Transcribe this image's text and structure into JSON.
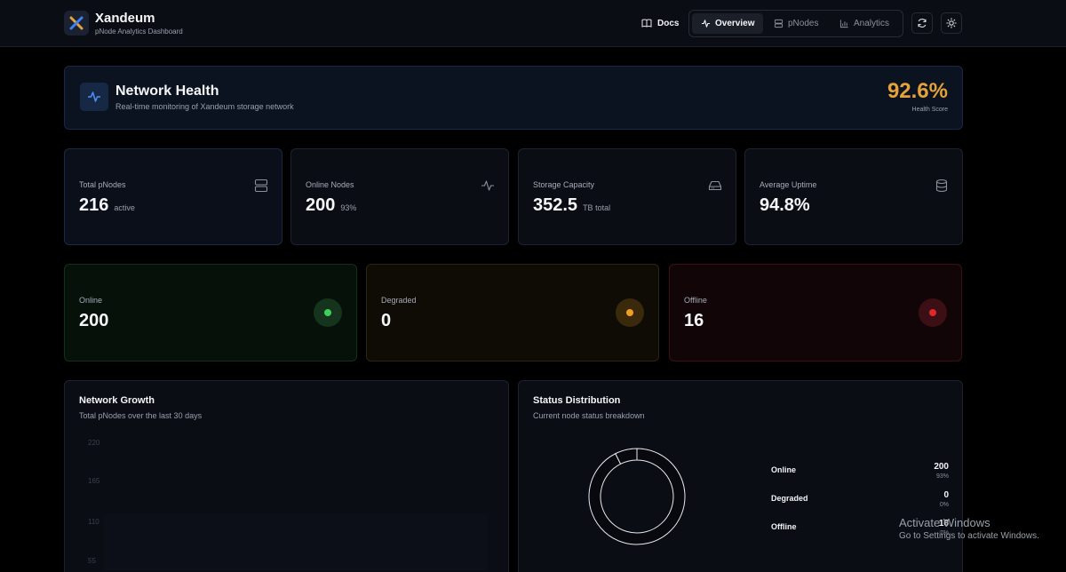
{
  "header": {
    "brand_title": "Xandeum",
    "brand_subtitle": "pNode Analytics Dashboard",
    "docs_label": "Docs",
    "tabs": [
      {
        "label": "Overview",
        "active": true
      },
      {
        "label": "pNodes",
        "active": false
      },
      {
        "label": "Analytics",
        "active": false
      }
    ]
  },
  "health": {
    "title": "Network Health",
    "subtitle": "Real-time monitoring of Xandeum storage network",
    "score": "92.6%",
    "score_label": "Health Score",
    "score_color": "#e5a23a"
  },
  "stats": [
    {
      "label": "Total pNodes",
      "value": "216",
      "unit": "active",
      "icon": "server-icon"
    },
    {
      "label": "Online Nodes",
      "value": "200",
      "unit": "93%",
      "icon": "activity-icon"
    },
    {
      "label": "Storage Capacity",
      "value": "352.5",
      "unit": "TB total",
      "icon": "hard-drive-icon"
    },
    {
      "label": "Average Uptime",
      "value": "94.8%",
      "unit": "",
      "icon": "database-icon"
    }
  ],
  "status_cards": [
    {
      "label": "Online",
      "value": "200",
      "color": "#3fcf5a"
    },
    {
      "label": "Degraded",
      "value": "0",
      "color": "#f0a020"
    },
    {
      "label": "Offline",
      "value": "16",
      "color": "#e0262e"
    }
  ],
  "growth": {
    "title": "Network Growth",
    "subtitle": "Total pNodes over the last 30 days",
    "y_ticks": [
      "220",
      "165",
      "110",
      "55"
    ]
  },
  "distribution": {
    "title": "Status Distribution",
    "subtitle": "Current node status breakdown",
    "legend": [
      {
        "name": "Online",
        "value": "200",
        "pct": "93%"
      },
      {
        "name": "Degraded",
        "value": "0",
        "pct": "0%"
      },
      {
        "name": "Offline",
        "value": "16",
        "pct": "7%"
      }
    ]
  },
  "chart_data": {
    "type": "pie",
    "title": "Status Distribution",
    "categories": [
      "Online",
      "Degraded",
      "Offline"
    ],
    "values": [
      200,
      0,
      16
    ]
  },
  "watermark": {
    "title": "Activate Windows",
    "subtitle": "Go to Settings to activate Windows."
  }
}
